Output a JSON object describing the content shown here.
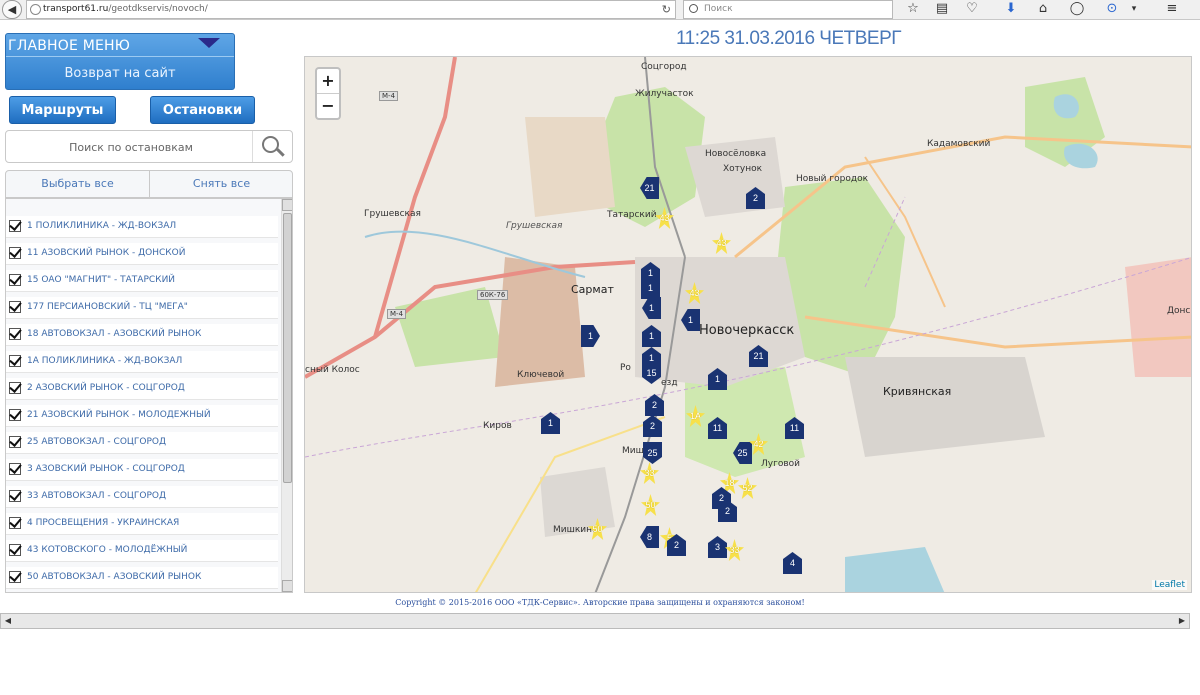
{
  "browser": {
    "url_domain": "transport61.ru",
    "url_path": "/geotdkservis/novoch/",
    "search_placeholder": "Поиск",
    "back_icon": "back-arrow-icon",
    "reload_icon": "reload-icon"
  },
  "header": {
    "datetime": "11:25 31.03.2016 ЧЕТВЕРГ"
  },
  "menu": {
    "title": "ГЛАВНОЕ МЕНЮ",
    "return_label": "Возврат на сайт"
  },
  "tabs": {
    "routes": "Маршруты",
    "stops": "Остановки"
  },
  "stop_search": {
    "placeholder": "Поиск по остановкам"
  },
  "selection": {
    "select_all": "Выбрать все",
    "deselect_all": "Снять все"
  },
  "routes": [
    {
      "label": "1 ПОЛИКЛИНИКА - ЖД-ВОКЗАЛ",
      "checked": true
    },
    {
      "label": "11 АЗОВСКИЙ РЫНОК - ДОНСКОЙ",
      "checked": true
    },
    {
      "label": "15 ОАО \"МАГНИТ\" - ТАТАРСКИЙ",
      "checked": true
    },
    {
      "label": "177 ПЕРСИАНОВСКИЙ - ТЦ \"МЕГА\"",
      "checked": true
    },
    {
      "label": "18 АВТОВОКЗАЛ - АЗОВСКИЙ РЫНОК",
      "checked": true
    },
    {
      "label": "1А ПОЛИКЛИНИКА - ЖД-ВОКЗАЛ",
      "checked": true
    },
    {
      "label": "2 АЗОВСКИЙ РЫНОК - СОЦГОРОД",
      "checked": true
    },
    {
      "label": "21 АЗОВСКИЙ РЫНОК - МОЛОДЕЖНЫЙ",
      "checked": true
    },
    {
      "label": "25 АВТОВОКЗАЛ - СОЦГОРОД",
      "checked": true
    },
    {
      "label": "3 АЗОВСКИЙ РЫНОК - СОЦГОРОД",
      "checked": true
    },
    {
      "label": "33 АВТОВОКЗАЛ - СОЦГОРОД",
      "checked": true
    },
    {
      "label": "4 ПРОСВЕЩЕНИЯ - УКРАИНСКАЯ",
      "checked": true
    },
    {
      "label": "43 КОТОВСКОГО - МОЛОДЁЖНЫЙ",
      "checked": true
    },
    {
      "label": "50 АВТОВОКЗАЛ - АЗОВСКИЙ РЫНОК",
      "checked": true
    }
  ],
  "map": {
    "zoom_in": "+",
    "zoom_out": "−",
    "attribution": "Leaflet",
    "places": {
      "socgorod": "Соцгород",
      "zhilustachok": "Жилучасток",
      "novoselovka": "Новосёловка",
      "khotunok": "Хотунок",
      "noviy_gorodok": "Новый городок",
      "kadamovskiy": "Кадамовский",
      "tatarskiy": "Татарский",
      "grushevskaya": "Грушевская",
      "grushevskaya_river": "Грушевская",
      "sarmat": "Сармат",
      "novocherkassk": "Новочеркасск",
      "krivyanskaya": "Кривянская",
      "donskoy": "Донско",
      "klyuchevoy": "Ключевой",
      "kirov": "Киров",
      "krasny_kolos": "сный Колос",
      "mishkin": "Мишкин",
      "mishkino": "Мишкино",
      "lugovoy": "Луговой",
      "proezd": "езд",
      "ro": "Ро"
    },
    "roads": {
      "m4_top": "М-4",
      "m4_left": "М-4",
      "r60k76": "60К-76"
    },
    "vehicles": [
      {
        "route": "21",
        "color": "navy",
        "dir": "left"
      },
      {
        "route": "2",
        "color": "navy",
        "dir": "up"
      },
      {
        "route": "43",
        "color": "yellow",
        "dir": "star"
      },
      {
        "route": "43",
        "color": "yellow",
        "dir": "star"
      },
      {
        "route": "1",
        "color": "navy",
        "dir": "up"
      },
      {
        "route": "1",
        "color": "navy",
        "dir": "up"
      },
      {
        "route": "43",
        "color": "yellow",
        "dir": "star"
      },
      {
        "route": "1",
        "color": "navy",
        "dir": "left"
      },
      {
        "route": "1",
        "color": "navy",
        "dir": "left"
      },
      {
        "route": "1",
        "color": "navy",
        "dir": "up"
      },
      {
        "route": "21",
        "color": "navy",
        "dir": "up"
      },
      {
        "route": "1",
        "color": "navy",
        "dir": "up"
      },
      {
        "route": "15",
        "color": "navy",
        "dir": "down"
      },
      {
        "route": "1",
        "color": "navy",
        "dir": "up"
      },
      {
        "route": "1",
        "color": "navy",
        "dir": "right"
      },
      {
        "route": "1",
        "color": "navy",
        "dir": "up"
      },
      {
        "route": "2",
        "color": "navy",
        "dir": "up"
      },
      {
        "route": "2",
        "color": "navy",
        "dir": "up"
      },
      {
        "route": "11",
        "color": "navy",
        "dir": "up"
      },
      {
        "route": "1А",
        "color": "yellow",
        "dir": "star"
      },
      {
        "route": "25",
        "color": "navy",
        "dir": "down"
      },
      {
        "route": "25",
        "color": "navy",
        "dir": "left"
      },
      {
        "route": "42",
        "color": "yellow",
        "dir": "star"
      },
      {
        "route": "33",
        "color": "yellow",
        "dir": "star"
      },
      {
        "route": "11",
        "color": "navy",
        "dir": "up"
      },
      {
        "route": "18",
        "color": "yellow",
        "dir": "star"
      },
      {
        "route": "52",
        "color": "yellow",
        "dir": "star"
      },
      {
        "route": "2",
        "color": "navy",
        "dir": "up"
      },
      {
        "route": "2",
        "color": "navy",
        "dir": "up"
      },
      {
        "route": "50",
        "color": "yellow",
        "dir": "star"
      },
      {
        "route": "50",
        "color": "yellow",
        "dir": "star"
      },
      {
        "route": "8",
        "color": "navy",
        "dir": "left"
      },
      {
        "route": "5",
        "color": "yellow",
        "dir": "star"
      },
      {
        "route": "2",
        "color": "navy",
        "dir": "up"
      },
      {
        "route": "3",
        "color": "navy",
        "dir": "up"
      },
      {
        "route": "33",
        "color": "yellow",
        "dir": "star"
      },
      {
        "route": "4",
        "color": "navy",
        "dir": "up"
      }
    ]
  },
  "footer": {
    "copyright": "Copyright © 2015-2016 ООО «ТДК-Сервис». Авторские права защищены и охраняются законом!"
  },
  "colors": {
    "accent_blue": "#2f7fce",
    "marker_navy": "#1a3372",
    "marker_yellow": "#f7e04a",
    "link_blue": "#3d6aa8"
  }
}
